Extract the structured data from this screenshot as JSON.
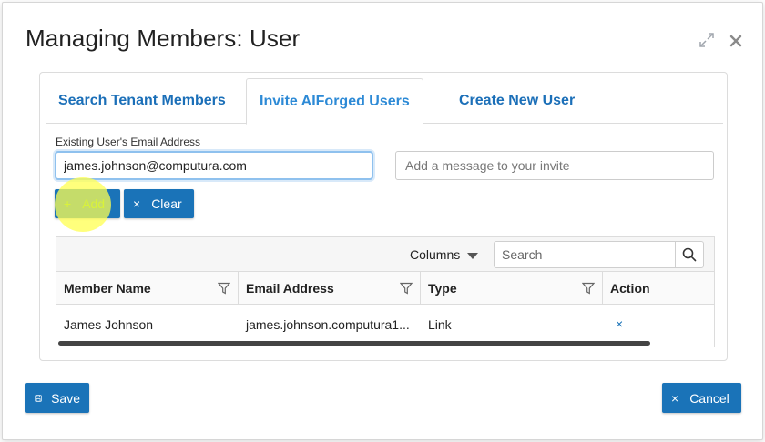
{
  "dialog": {
    "title": "Managing Members: User"
  },
  "tabs": [
    {
      "label": "Search Tenant Members",
      "active": false
    },
    {
      "label": "Invite AIForged Users",
      "active": true
    },
    {
      "label": "Create New User",
      "active": false
    }
  ],
  "invite_form": {
    "email_label": "Existing User's Email Address",
    "email_value": "james.johnson@computura.com",
    "message_placeholder": "Add a message to your invite",
    "add_label": "Add",
    "clear_label": "Clear"
  },
  "grid": {
    "columns_label": "Columns",
    "search_placeholder": "Search",
    "headers": [
      "Member Name",
      "Email Address",
      "Type",
      "Action"
    ],
    "rows": [
      {
        "member_name": "James Johnson",
        "email": "james.johnson.computura1...",
        "type": "Link",
        "action": "×"
      }
    ]
  },
  "footer": {
    "save_label": "Save",
    "cancel_label": "Cancel"
  },
  "colors": {
    "primary": "#1a73b8",
    "tab_text": "#1b6fb8",
    "tab_active_text": "#2d8ad6",
    "highlight": "#ffff50"
  }
}
